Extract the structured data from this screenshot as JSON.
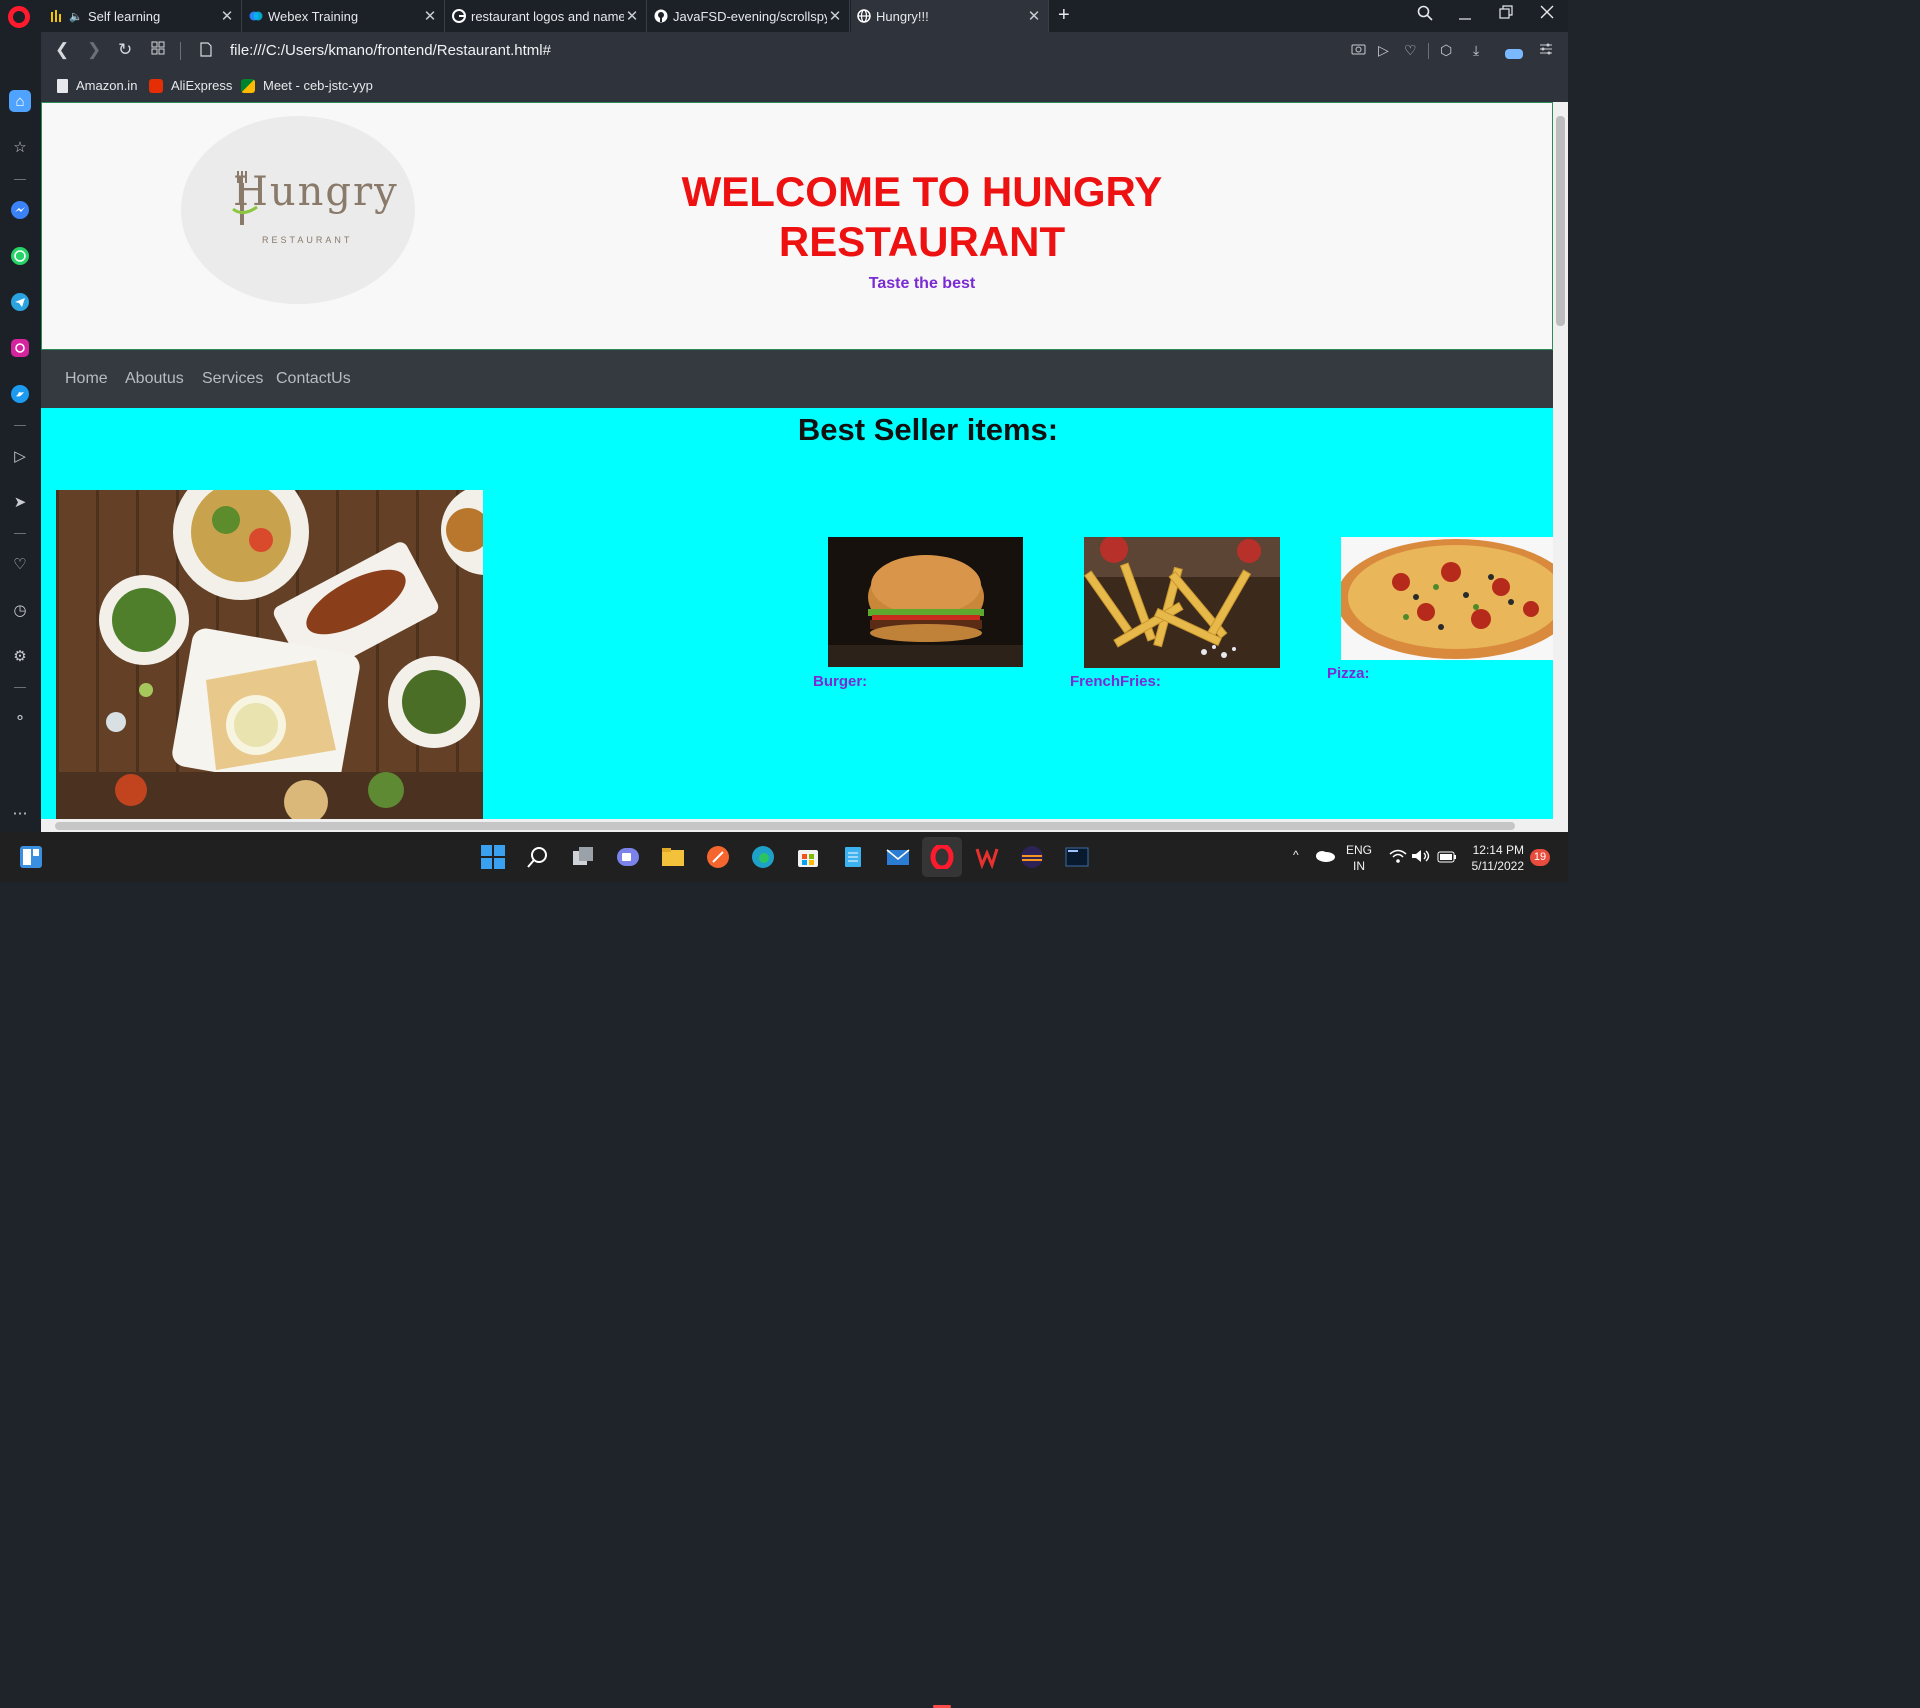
{
  "browser": {
    "tabs": [
      {
        "label": "Self learning",
        "icon": "bar-chart-icon"
      },
      {
        "label": "Webex Training",
        "icon": "webex-icon"
      },
      {
        "label": "restaurant logos and name",
        "icon": "google-icon"
      },
      {
        "label": "JavaFSD-evening/scrollspy.",
        "icon": "github-icon"
      },
      {
        "label": "Hungry!!!",
        "icon": "globe-icon",
        "active": true
      }
    ],
    "url": "file:///C:/Users/kmano/frontend/Restaurant.html#",
    "bookmarks": [
      {
        "label": "Amazon.in"
      },
      {
        "label": "AliExpress"
      },
      {
        "label": "Meet - ceb-jstc-yyp"
      }
    ]
  },
  "page": {
    "logo": {
      "word": "Hungry",
      "sub": "RESTAURANT"
    },
    "header": {
      "title": "WELCOME TO HUNGRY RESTAURANT",
      "tagline": "Taste the best"
    },
    "nav": [
      "Home",
      "Aboutus",
      "Services",
      "ContactUs"
    ],
    "best_seller_title": "Best Seller items:",
    "items": [
      {
        "label": "Burger:"
      },
      {
        "label": "FrenchFries:"
      },
      {
        "label": "Pizza:"
      }
    ],
    "colors": {
      "title": "#ee1111",
      "tagline": "#7b2bd4",
      "content_bg": "#00ffff",
      "nav_bg": "#343a40"
    }
  },
  "taskbar": {
    "language": "ENG",
    "region": "IN",
    "time": "12:14 PM",
    "date": "5/11/2022",
    "notification_count": "19"
  }
}
